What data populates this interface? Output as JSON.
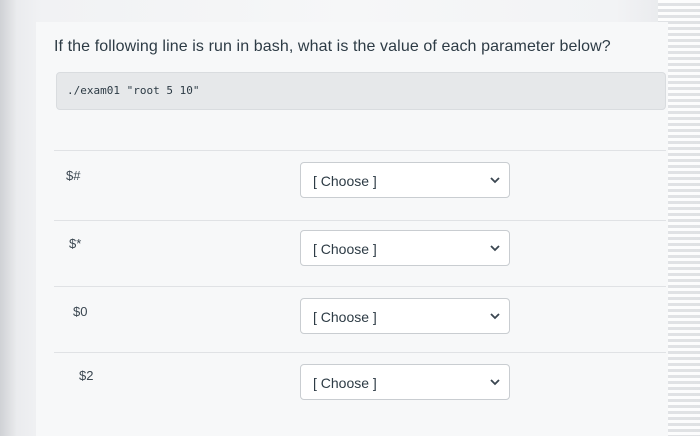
{
  "question": {
    "text": "If the following line is run in bash, what is the value of each parameter below?"
  },
  "command": {
    "text": "./exam01 \"root 5 10\""
  },
  "rows": [
    {
      "label": "$#",
      "select_value": "[ Choose ]"
    },
    {
      "label": "$*",
      "select_value": "[ Choose ]"
    },
    {
      "label": "$0",
      "select_value": "[ Choose ]"
    },
    {
      "label": "$2",
      "select_value": "[ Choose ]"
    }
  ],
  "icons": {
    "dropdown": "chevron-down-icon"
  },
  "colors": {
    "text": "#2d3b45",
    "code_bg": "#e6e8ea",
    "select_border": "#c9cdd1"
  }
}
